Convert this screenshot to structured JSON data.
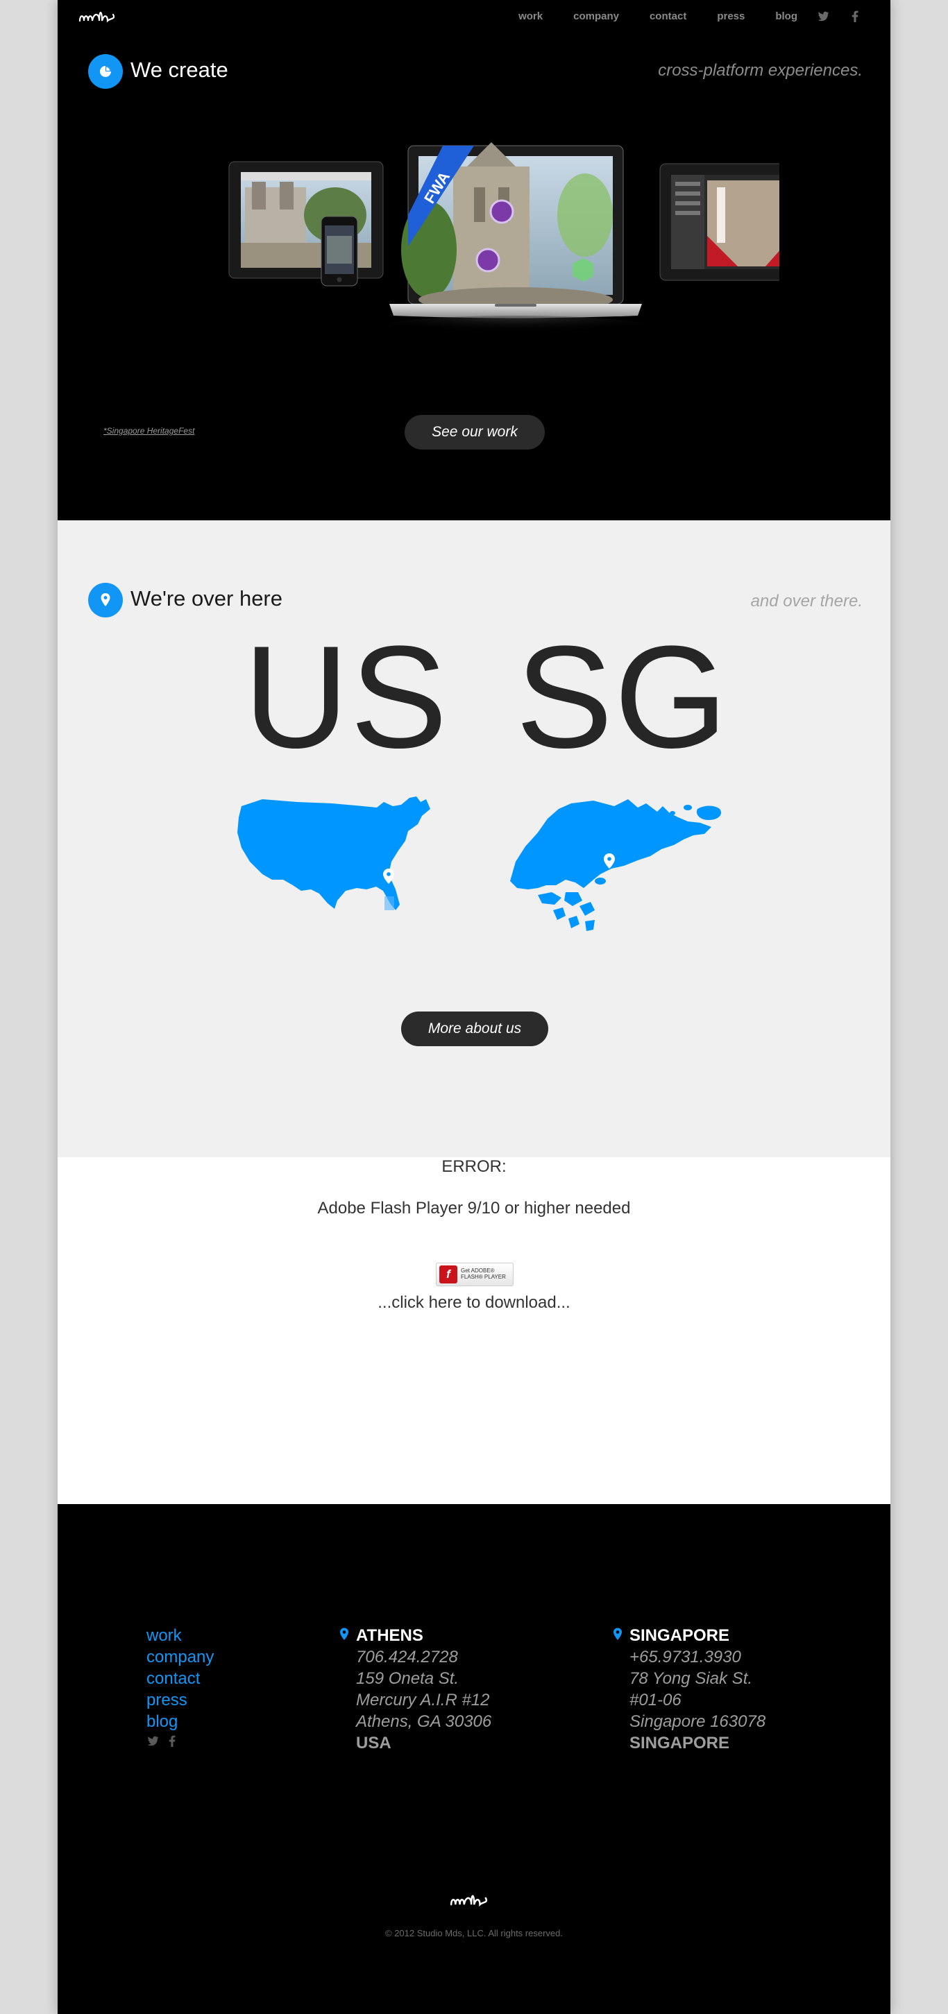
{
  "header": {
    "logo_text": "mds",
    "nav": [
      "work",
      "company",
      "contact",
      "press",
      "blog"
    ],
    "social": [
      "twitter-icon",
      "facebook-icon"
    ]
  },
  "hero": {
    "title": "We create",
    "tagline": "cross-platform experiences.",
    "badge_text": "FWA",
    "caption": "*Singapore HeritageFest",
    "button": "See our work"
  },
  "locations": {
    "title": "We're over here",
    "tagline": "and over there.",
    "codes": [
      "US",
      "SG"
    ],
    "button": "More about us",
    "map_color": "#0096ff"
  },
  "flash": {
    "error": "ERROR:",
    "message": "Adobe Flash Player 9/10 or higher needed",
    "badge_get": "Get ADOBE®",
    "badge_product": "FLASH® PLAYER",
    "download": "...click here to download..."
  },
  "footer": {
    "nav": [
      "work",
      "company",
      "contact",
      "press",
      "blog"
    ],
    "offices": [
      {
        "city": "ATHENS",
        "lines": [
          "706.424.2728",
          "159 Oneta St.",
          "Mercury A.I.R #12",
          "Athens, GA 30306"
        ],
        "country": "USA"
      },
      {
        "city": "SINGAPORE",
        "lines": [
          "+65.9731.3930",
          "78 Yong Siak St.",
          "#01-06",
          "Singapore 163078"
        ],
        "country": "SINGAPORE"
      }
    ],
    "logo_text": "mds",
    "copyright": "© 2012 Studio Mds, LLC. All rights reserved."
  },
  "colors": {
    "accent": "#1296f5",
    "hero_bg": "#000000",
    "section_bg": "#f0f0f0"
  }
}
